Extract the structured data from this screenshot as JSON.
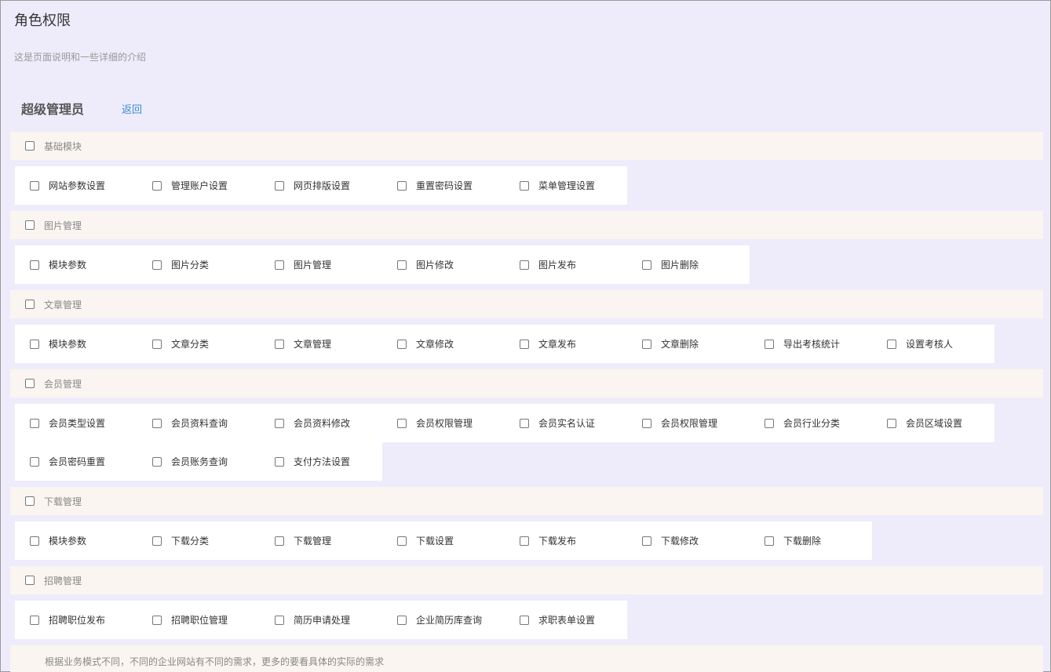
{
  "header": {
    "title": "角色权限",
    "description": "这是页面说明和一些详细的介绍"
  },
  "role": {
    "name": "超级管理员",
    "back_label": "返回"
  },
  "sections": [
    {
      "name": "基础模块",
      "items": [
        "网站参数设置",
        "管理账户设置",
        "网页排版设置",
        "重置密码设置",
        "菜单管理设置"
      ]
    },
    {
      "name": "图片管理",
      "items": [
        "模块参数",
        "图片分类",
        "图片管理",
        "图片修改",
        "图片发布",
        "图片删除"
      ]
    },
    {
      "name": "文章管理",
      "items": [
        "模块参数",
        "文章分类",
        "文章管理",
        "文章修改",
        "文章发布",
        "文章删除",
        "导出考核统计",
        "设置考核人"
      ]
    },
    {
      "name": "会员管理",
      "items": [
        "会员类型设置",
        "会员资料查询",
        "会员资料修改",
        "会员权限管理",
        "会员实名认证",
        "会员权限管理",
        "会员行业分类",
        "会员区域设置",
        "会员密码重置",
        "会员账务查询",
        "支付方法设置"
      ]
    },
    {
      "name": "下载管理",
      "items": [
        "模块参数",
        "下载分类",
        "下载管理",
        "下载设置",
        "下载发布",
        "下载修改",
        "下载删除"
      ]
    },
    {
      "name": "招聘管理",
      "items": [
        "招聘职位发布",
        "招聘职位管理",
        "简历申请处理",
        "企业简历库查询",
        "求职表单设置"
      ]
    }
  ],
  "footer_note": "根据业务模式不同，不同的企业网站有不同的需求，更多的要看具体的实际的需求",
  "colors": {
    "page_bg": "#eeecfb",
    "section_header_bg": "#faf5f0",
    "item_bg": "#ffffff",
    "link": "#3b8cd8"
  }
}
